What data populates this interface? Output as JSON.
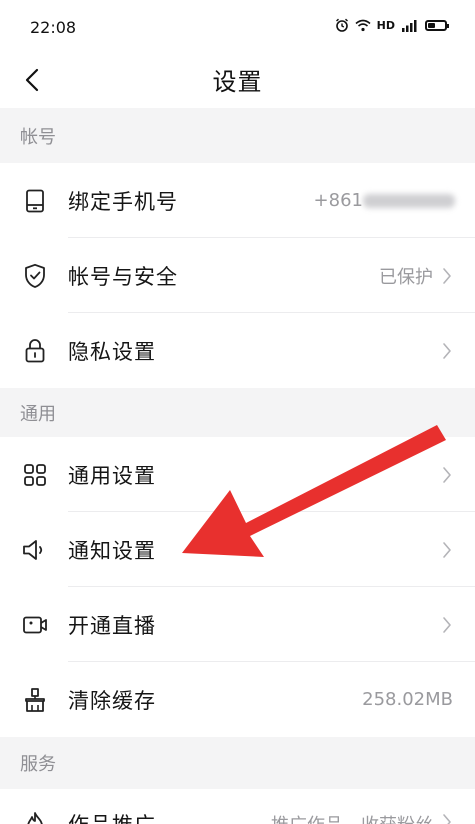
{
  "status_bar": {
    "time": "22:08",
    "icons": [
      "alarm-icon",
      "wifi-icon",
      "hd-badge",
      "signal-icon",
      "battery-icon"
    ],
    "hd_label": "HD"
  },
  "nav": {
    "title": "设置",
    "back_icon": "chevron-left-icon"
  },
  "sections": {
    "account": {
      "header": "帐号"
    },
    "general": {
      "header": "通用"
    },
    "service": {
      "header": "服务"
    }
  },
  "rows": {
    "bind_phone": {
      "label": "绑定手机号",
      "value": "+861",
      "icon": "phone-icon"
    },
    "account_security": {
      "label": "帐号与安全",
      "value": "已保护",
      "icon": "shield-icon"
    },
    "privacy": {
      "label": "隐私设置",
      "value": "",
      "icon": "lock-icon"
    },
    "general_settings": {
      "label": "通用设置",
      "value": "",
      "icon": "grid-icon"
    },
    "notification": {
      "label": "通知设置",
      "value": "",
      "icon": "speaker-icon"
    },
    "live": {
      "label": "开通直播",
      "value": "",
      "icon": "camera-icon"
    },
    "clear_cache": {
      "label": "清除缓存",
      "value": "258.02MB",
      "icon": "brush-icon"
    },
    "promotion": {
      "label": "作品推广",
      "value": "推广作品，收获粉丝",
      "icon": "flame-icon"
    }
  },
  "colors": {
    "background": "#ffffff",
    "section_bg": "#f4f4f5",
    "section_text": "#8f8f94",
    "value_text": "#9a9a9e",
    "arrow": "#e8302e"
  }
}
